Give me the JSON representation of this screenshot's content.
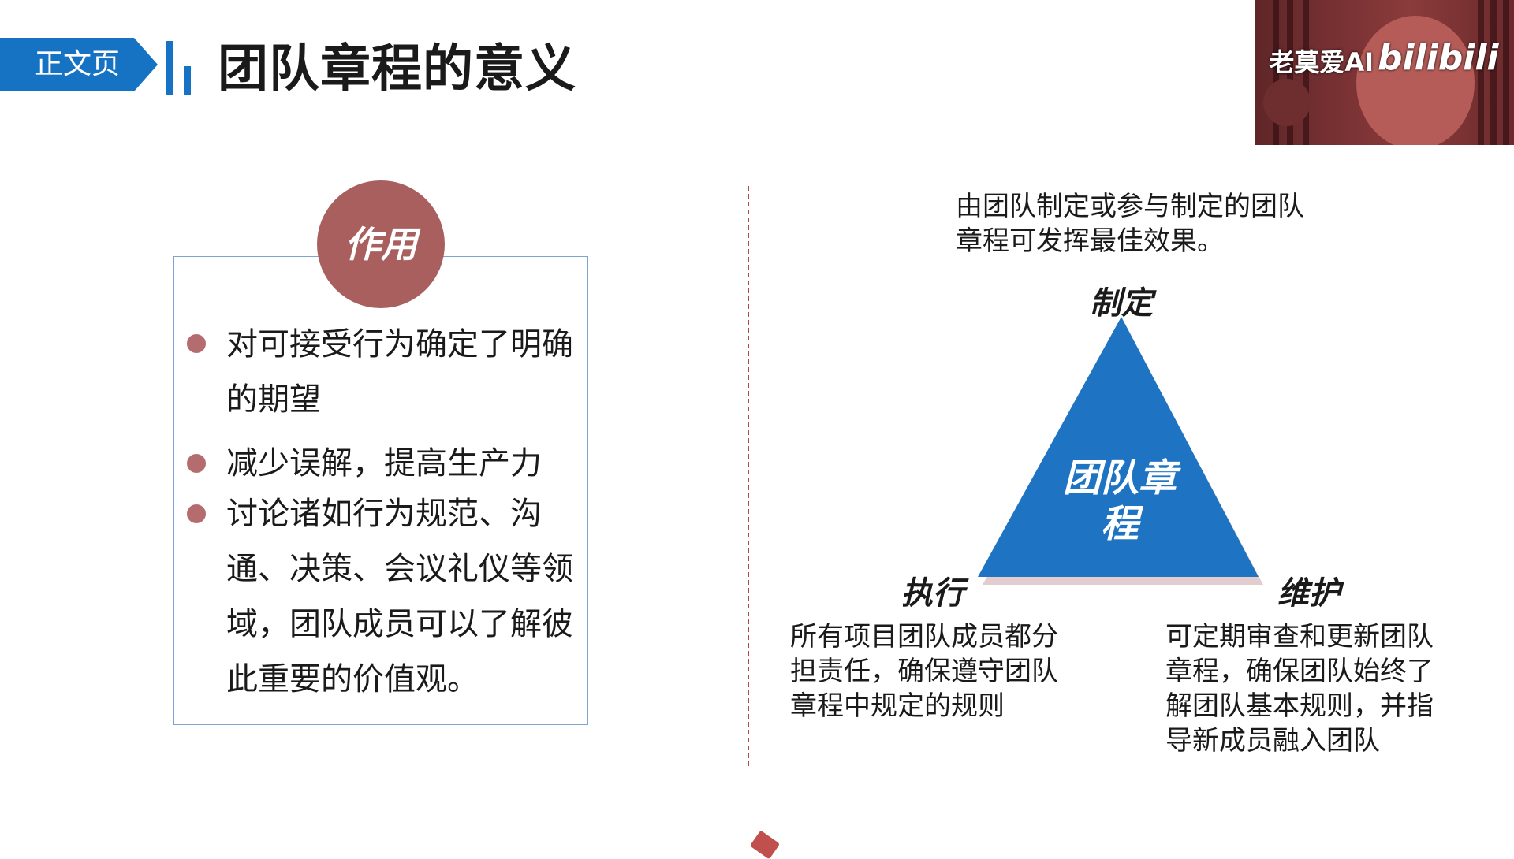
{
  "header": {
    "section_tag": "正文页",
    "title": "团队章程的意义"
  },
  "webcam": {
    "channel_name": "老莫爱AI",
    "platform_logo": "bilibili"
  },
  "role_panel": {
    "title": "作用",
    "bullets": [
      {
        "text": "对可接受行为确定了明确的期望"
      },
      {
        "text": "减少误解，提高生产力"
      },
      {
        "text": "讨论诸如行为规范、沟通、决策、会议礼仪等领域，团队成员可以了解彼此重要的价值观。"
      }
    ]
  },
  "diagram": {
    "top_note": "由团队制定或参与制定的团队章程可发挥最佳效果。",
    "core_label": "团队章程",
    "vertex_top": "制定",
    "vertex_left": "执行",
    "vertex_right": "维护",
    "note_left": "所有项目团队成员都分担责任，确保遵守团队章程中规定的规则",
    "note_right": "可定期审查和更新团队章程，确保团队始终了解团队基本规则，并指导新成员融入团队",
    "colors": {
      "triangle": "#1f73c3",
      "accent": "#a95f5e",
      "divider": "#b34747"
    }
  }
}
